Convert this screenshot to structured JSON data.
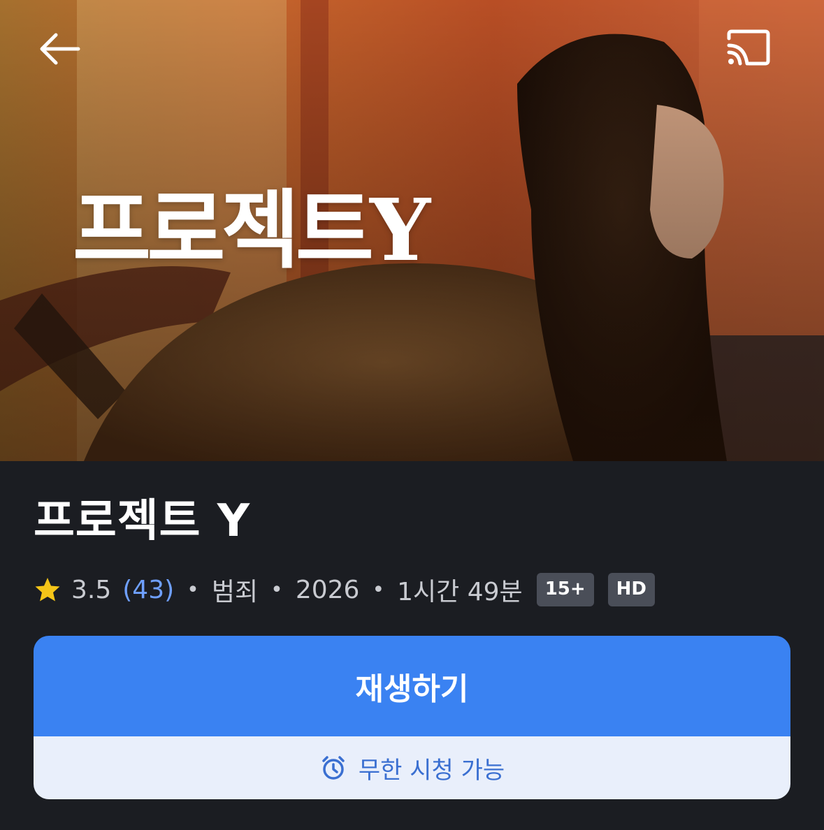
{
  "header": {
    "back_icon": "arrow-left-icon",
    "cast_icon": "cast-icon"
  },
  "poster": {
    "logo_text": "프로젝트Y"
  },
  "movie": {
    "title": "프로젝트 Y",
    "rating": "3.5",
    "rating_count": "(43)",
    "genre": "범죄",
    "year": "2026",
    "runtime": "1시간 49분",
    "age_badge": "15+",
    "quality_badge": "HD",
    "separator": "•"
  },
  "play": {
    "label": "재생하기",
    "availability": "무한 시청 가능",
    "accent_color": "#3a82f2"
  }
}
